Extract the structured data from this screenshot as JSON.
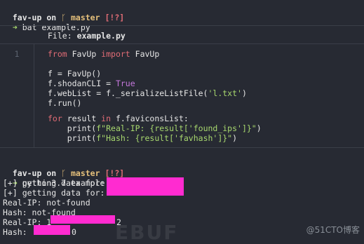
{
  "prompt1": {
    "dir": "fav-up",
    "on": "on",
    "branch_icon": "git-branch-icon",
    "branch": "master",
    "status": "[!?]"
  },
  "cmd1": {
    "arrow": "➜",
    "text": "bat example.py"
  },
  "file_header": {
    "label": "File:",
    "name": "example.py"
  },
  "gutter_number": "1",
  "code": [
    "from FavUp import FavUp",
    "",
    "f = FavUp()",
    "f.shodanCLI = True",
    "f.webList = f._serializeListFile('l.txt')",
    "f.run()",
    "",
    "for result in f.faviconsList:",
    "    print(f\"Real-IP: {result['found_ips']}\")",
    "    print(f\"Hash: {result['favhash']}\")"
  ],
  "prompt2": {
    "dir": "fav-up",
    "on": "on",
    "branch_icon": "git-branch-icon",
    "branch": "master",
    "status": "[!?]"
  },
  "cmd2": {
    "arrow": "➜",
    "text": "python3.7 example.py"
  },
  "output": [
    "[+] getting data for:",
    "[+] getting data for:",
    "Real-IP: not-found",
    "Hash: not-found",
    "Real-IP: 1",
    "Hash:"
  ],
  "output_tails": {
    "real_ip_end": "2",
    "hash_end": "0"
  },
  "redaction_color": "#ff2bd0",
  "watermark": "@51CTO博客",
  "freebuf": "EBUF"
}
